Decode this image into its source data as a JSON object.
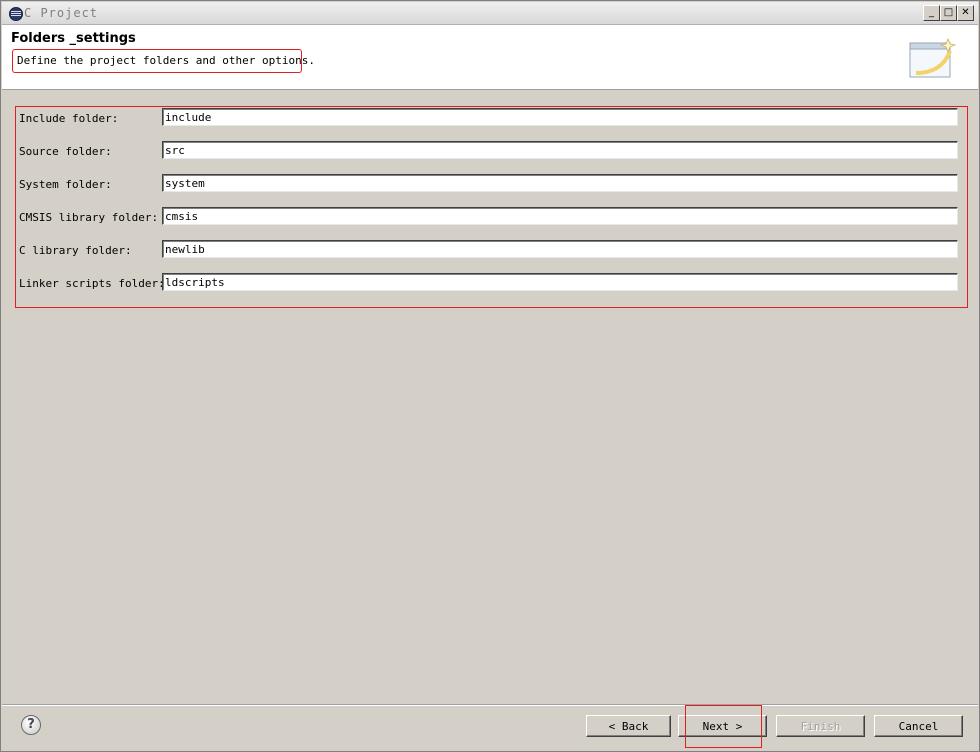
{
  "window": {
    "title": "C Project",
    "minimize_label": "_",
    "maximize_label": "□",
    "close_label": "✕"
  },
  "header": {
    "title": "Folders _settings",
    "description": "Define the project folders and other options."
  },
  "fields": [
    {
      "label": "Include folder:",
      "value": "include"
    },
    {
      "label": "Source folder:",
      "value": "src"
    },
    {
      "label": "System folder:",
      "value": "system"
    },
    {
      "label": "CMSIS library folder:",
      "value": "cmsis"
    },
    {
      "label": "C library folder:",
      "value": "newlib"
    },
    {
      "label": "Linker scripts folder:",
      "value": "ldscripts"
    }
  ],
  "buttons": {
    "help": "?",
    "back": "< Back",
    "next": "Next >",
    "finish": "Finish",
    "cancel": "Cancel"
  },
  "colors": {
    "highlight": "#e02020",
    "dialog_bg": "#d4d0c8"
  }
}
